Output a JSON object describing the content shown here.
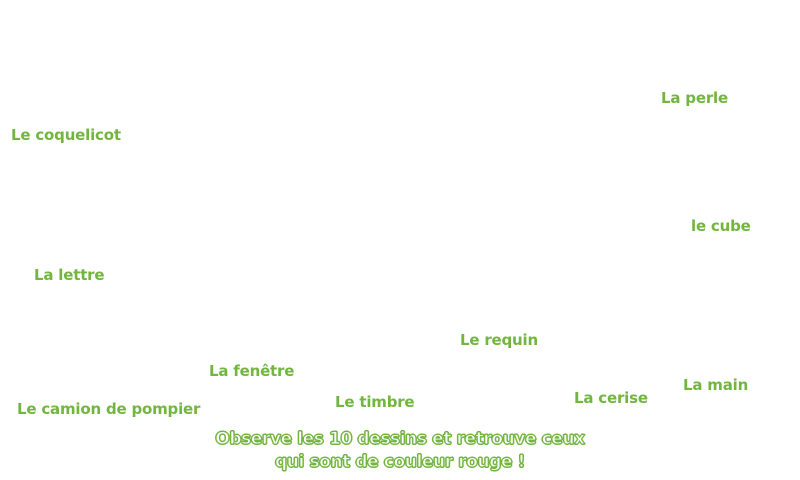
{
  "labels": {
    "perle": "La perle",
    "coquelicot": "Le coquelicot",
    "cube": "le cube",
    "lettre": "La lettre",
    "requin": "Le requin",
    "fenetre": "La fenêtre",
    "main": "La main",
    "cerise": "La cerise",
    "timbre": "Le timbre",
    "camion": "Le camion de pompier"
  },
  "instruction": {
    "line1": "Observe les 10 dessins et retrouve ceux",
    "line2": "qui sont de couleur rouge !"
  },
  "colors": {
    "label_green": "#72b53f",
    "background": "#ffffff"
  }
}
